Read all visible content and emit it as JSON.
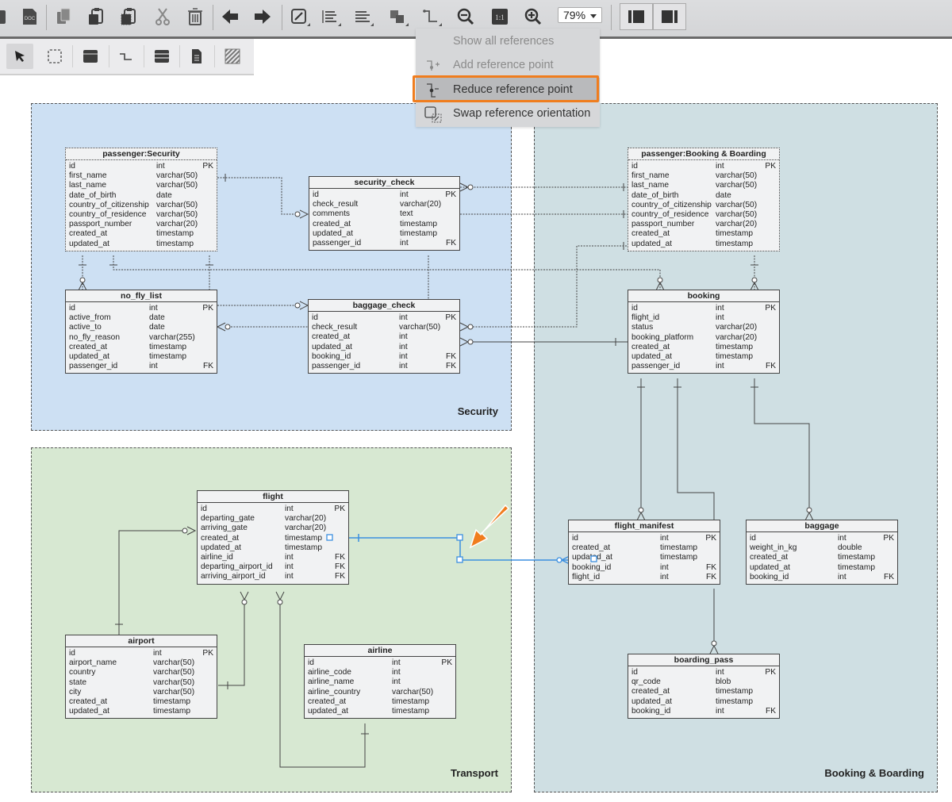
{
  "toolbar": {
    "buttons": [
      {
        "name": "db-icon"
      },
      {
        "name": "doc-icon",
        "label": "DOC"
      },
      {
        "name": "copy-icon"
      },
      {
        "name": "paste-icon"
      },
      {
        "name": "paste-special-icon"
      },
      {
        "name": "cut-icon"
      },
      {
        "name": "delete-icon"
      },
      {
        "name": "undo-arrow-icon"
      },
      {
        "name": "redo-arrow-icon"
      },
      {
        "name": "edit-line-icon"
      },
      {
        "name": "align-left-icon"
      },
      {
        "name": "align-right-icon"
      },
      {
        "name": "arrange-icon"
      },
      {
        "name": "reference-icon"
      },
      {
        "name": "zoom-out-icon"
      },
      {
        "name": "actual-size-icon",
        "label": "1:1"
      },
      {
        "name": "zoom-in-icon"
      }
    ],
    "zoom_level": "79%",
    "view_buttons": [
      "left-panel-icon",
      "right-panel-icon"
    ]
  },
  "palette": {
    "tools": [
      "select-pointer-icon",
      "area-select-icon",
      "table-icon",
      "relationship-icon",
      "view-icon",
      "note-icon",
      "hatch-area-icon"
    ]
  },
  "reference_menu": {
    "items": [
      {
        "label": "Show all references",
        "state": "disabled"
      },
      {
        "label": "Add reference point",
        "state": "disabled"
      },
      {
        "label": "Reduce reference point",
        "state": "highlighted"
      },
      {
        "label": "Swap reference orientation",
        "state": "enabled"
      }
    ]
  },
  "areas": {
    "security": {
      "label": "Security",
      "color": "#cde0f3"
    },
    "transport": {
      "label": "Transport",
      "color": "#d7e8d2"
    },
    "booking": {
      "label": "Booking & Boarding",
      "color": "#cfdfe3"
    }
  },
  "colors": {
    "highlight": "#f07d1e",
    "selected_line": "#3b8fe0"
  },
  "tables": {
    "passenger_security": {
      "title": "passenger:Security",
      "rows": [
        [
          "id",
          "int",
          "PK"
        ],
        [
          "first_name",
          "varchar(50)",
          ""
        ],
        [
          "last_name",
          "varchar(50)",
          ""
        ],
        [
          "date_of_birth",
          "date",
          ""
        ],
        [
          "country_of_citizenship",
          "varchar(50)",
          ""
        ],
        [
          "country_of_residence",
          "varchar(50)",
          ""
        ],
        [
          "passport_number",
          "varchar(20)",
          ""
        ],
        [
          "created_at",
          "timestamp",
          ""
        ],
        [
          "updated_at",
          "timestamp",
          ""
        ]
      ]
    },
    "security_check": {
      "title": "security_check",
      "rows": [
        [
          "id",
          "int",
          "PK"
        ],
        [
          "check_result",
          "varchar(20)",
          ""
        ],
        [
          "comments",
          "text",
          ""
        ],
        [
          "created_at",
          "timestamp",
          ""
        ],
        [
          "updated_at",
          "timestamp",
          ""
        ],
        [
          "passenger_id",
          "int",
          "FK"
        ]
      ]
    },
    "no_fly_list": {
      "title": "no_fly_list",
      "rows": [
        [
          "id",
          "int",
          "PK"
        ],
        [
          "active_from",
          "date",
          ""
        ],
        [
          "active_to",
          "date",
          ""
        ],
        [
          "no_fly_reason",
          "varchar(255)",
          ""
        ],
        [
          "created_at",
          "timestamp",
          ""
        ],
        [
          "updated_at",
          "timestamp",
          ""
        ],
        [
          "passenger_id",
          "int",
          "FK"
        ]
      ]
    },
    "baggage_check": {
      "title": "baggage_check",
      "rows": [
        [
          "id",
          "int",
          "PK"
        ],
        [
          "check_result",
          "varchar(50)",
          ""
        ],
        [
          "created_at",
          "int",
          ""
        ],
        [
          "updated_at",
          "int",
          ""
        ],
        [
          "booking_id",
          "int",
          "FK"
        ],
        [
          "passenger_id",
          "int",
          "FK"
        ]
      ]
    },
    "passenger_booking": {
      "title": "passenger:Booking & Boarding",
      "rows": [
        [
          "id",
          "int",
          "PK"
        ],
        [
          "first_name",
          "varchar(50)",
          ""
        ],
        [
          "last_name",
          "varchar(50)",
          ""
        ],
        [
          "date_of_birth",
          "date",
          ""
        ],
        [
          "country_of_citizenship",
          "varchar(50)",
          ""
        ],
        [
          "country_of_residence",
          "varchar(50)",
          ""
        ],
        [
          "passport_number",
          "varchar(20)",
          ""
        ],
        [
          "created_at",
          "timestamp",
          ""
        ],
        [
          "updated_at",
          "timestamp",
          ""
        ]
      ]
    },
    "booking": {
      "title": "booking",
      "rows": [
        [
          "id",
          "int",
          "PK"
        ],
        [
          "flight_id",
          "int",
          ""
        ],
        [
          "status",
          "varchar(20)",
          ""
        ],
        [
          "booking_platform",
          "varchar(20)",
          ""
        ],
        [
          "created_at",
          "timestamp",
          ""
        ],
        [
          "updated_at",
          "timestamp",
          ""
        ],
        [
          "passenger_id",
          "int",
          "FK"
        ]
      ]
    },
    "flight": {
      "title": "flight",
      "rows": [
        [
          "id",
          "int",
          "PK"
        ],
        [
          "departing_gate",
          "varchar(20)",
          ""
        ],
        [
          "arriving_gate",
          "varchar(20)",
          ""
        ],
        [
          "created_at",
          "timestamp",
          ""
        ],
        [
          "updated_at",
          "timestamp",
          ""
        ],
        [
          "airline_id",
          "int",
          "FK"
        ],
        [
          "departing_airport_id",
          "int",
          "FK"
        ],
        [
          "arriving_airport_id",
          "int",
          "FK"
        ]
      ]
    },
    "flight_manifest": {
      "title": "flight_manifest",
      "rows": [
        [
          "id",
          "int",
          "PK"
        ],
        [
          "created_at",
          "timestamp",
          ""
        ],
        [
          "updated_at",
          "timestamp",
          ""
        ],
        [
          "booking_id",
          "int",
          "FK"
        ],
        [
          "flight_id",
          "int",
          "FK"
        ]
      ]
    },
    "baggage": {
      "title": "baggage",
      "rows": [
        [
          "id",
          "int",
          "PK"
        ],
        [
          "weight_in_kg",
          "double",
          ""
        ],
        [
          "created_at",
          "timestamp",
          ""
        ],
        [
          "updated_at",
          "timestamp",
          ""
        ],
        [
          "booking_id",
          "int",
          "FK"
        ]
      ]
    },
    "airport": {
      "title": "airport",
      "rows": [
        [
          "id",
          "int",
          "PK"
        ],
        [
          "airport_name",
          "varchar(50)",
          ""
        ],
        [
          "country",
          "varchar(50)",
          ""
        ],
        [
          "state",
          "varchar(50)",
          ""
        ],
        [
          "city",
          "varchar(50)",
          ""
        ],
        [
          "created_at",
          "timestamp",
          ""
        ],
        [
          "updated_at",
          "timestamp",
          ""
        ]
      ]
    },
    "airline": {
      "title": "airline",
      "rows": [
        [
          "id",
          "int",
          "PK"
        ],
        [
          "airline_code",
          "int",
          ""
        ],
        [
          "airline_name",
          "int",
          ""
        ],
        [
          "airline_country",
          "varchar(50)",
          ""
        ],
        [
          "created_at",
          "timestamp",
          ""
        ],
        [
          "updated_at",
          "timestamp",
          ""
        ]
      ]
    },
    "boarding_pass": {
      "title": "boarding_pass",
      "rows": [
        [
          "id",
          "int",
          "PK"
        ],
        [
          "qr_code",
          "blob",
          ""
        ],
        [
          "created_at",
          "timestamp",
          ""
        ],
        [
          "updated_at",
          "timestamp",
          ""
        ],
        [
          "booking_id",
          "int",
          "FK"
        ]
      ]
    }
  }
}
